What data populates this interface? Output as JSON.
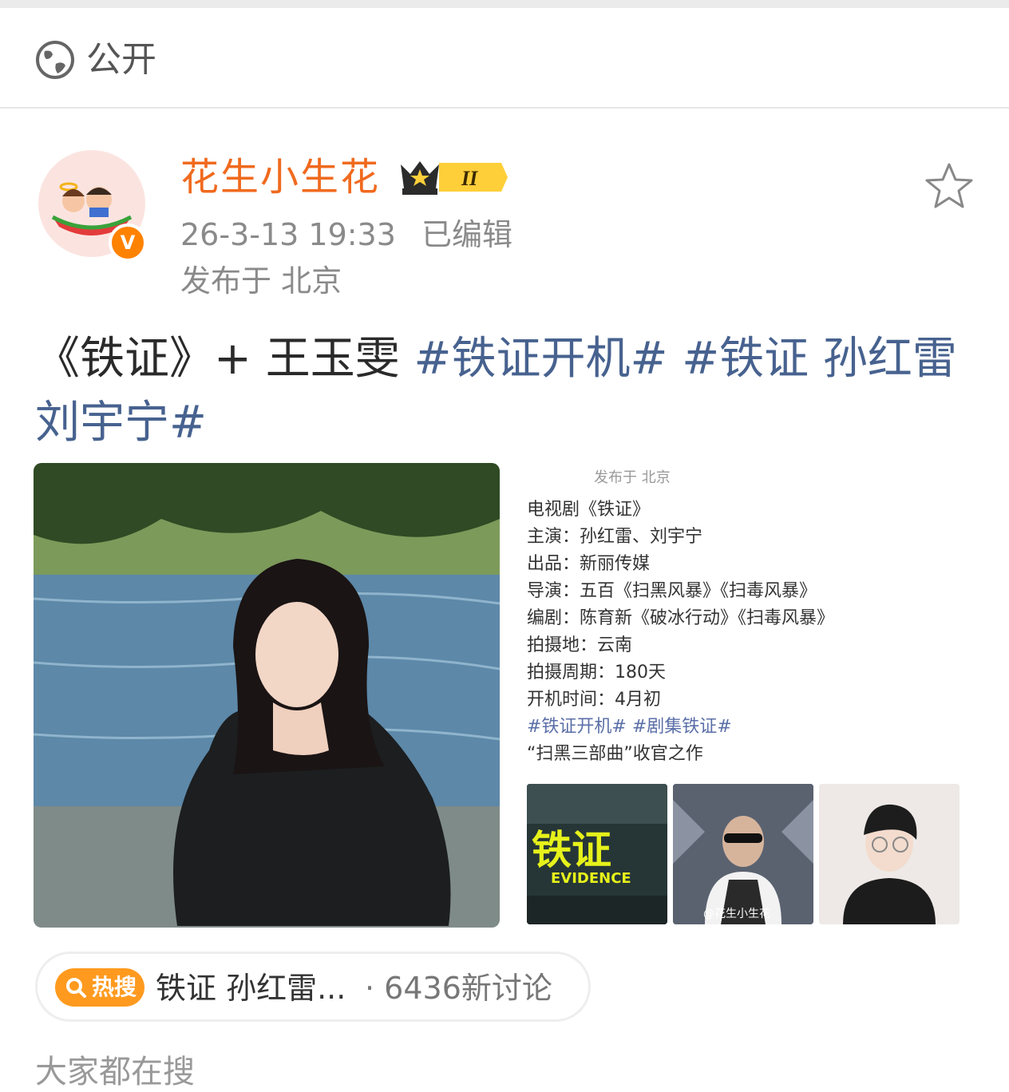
{
  "visibility": {
    "label": "公开",
    "icon": "globe-icon"
  },
  "author": {
    "name": "花生小生花",
    "level_badge": "II",
    "time": "26-3-13 19:33",
    "edited": "已编辑",
    "location": "发布于 北京",
    "verified_mark": "V"
  },
  "post": {
    "title": "《铁证》+ 王玉雯",
    "hashtags": [
      "#铁证开机#",
      "#铁证 孙红雷刘宇宁#"
    ]
  },
  "info_card": {
    "location": "发布于 北京",
    "lines": [
      "电视剧《铁证》",
      "主演：孙红雷、刘宇宁",
      "出品：新丽传媒",
      "导演：五百《扫黑风暴》《扫毒风暴》",
      "编剧：陈育新《破冰行动》《扫毒风暴》",
      "拍摄地：云南",
      "拍摄周期：180天",
      "开机时间：4月初"
    ],
    "tags": "#铁证开机# #剧集铁证#",
    "tagline": "“扫黑三部曲”收官之作",
    "poster_title": "铁证",
    "poster_subtitle": "EVIDENCE",
    "watermark": "@花生小生花"
  },
  "hot_search": {
    "badge": "热搜",
    "text": "铁证 孙红雷...",
    "count": "· 6436新讨论"
  },
  "section": {
    "title": "大家都在搜"
  },
  "colors": {
    "accent": "#f06a1e",
    "hashtag": "#47628f",
    "hot": "#ff9a1f"
  }
}
